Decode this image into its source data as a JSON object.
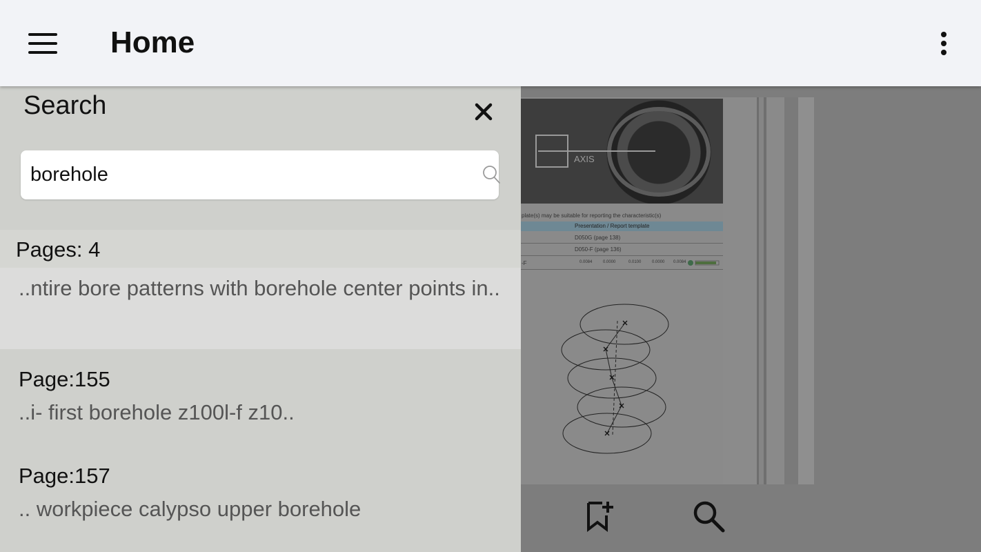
{
  "appbar": {
    "title": "Home",
    "menu_icon": "hamburger-menu-icon",
    "overflow_icon": "more-vert-icon"
  },
  "search_panel": {
    "title": "Search",
    "close_icon": "close-icon",
    "query": "borehole",
    "search_icon": "search-icon",
    "pages_label": "Pages: 4",
    "results": [
      {
        "page": "",
        "snippet": "..ntire bore patterns with borehole center points in.."
      },
      {
        "page": "Page:155",
        "snippet": "..i- first borehole z100l-f z10.."
      },
      {
        "page": "Page:157",
        "snippet": ".. workpiece calypso upper borehole"
      }
    ]
  },
  "document": {
    "hero_text": "AXIS",
    "caption": "plate(s) may be suitable for reporting the characteristic(s)",
    "table_header": "Presentation / Report template",
    "table_rows": [
      "D050G (page 138)",
      "D050-F (page 136)"
    ],
    "value_row_label": "-F",
    "values": [
      "0.0084",
      "0.0000",
      "0.0100",
      "0.0000",
      "0.0084"
    ]
  },
  "bottom_toolbar": {
    "bookmark_icon": "bookmark-add-icon",
    "search_icon": "search-icon"
  }
}
